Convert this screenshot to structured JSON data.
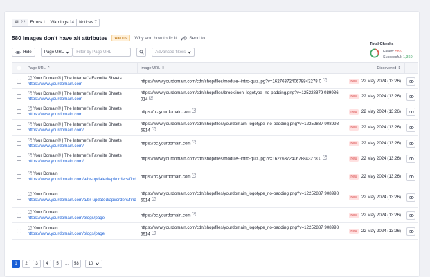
{
  "issue_tabs": [
    {
      "label": "All",
      "count": "22",
      "active": true
    },
    {
      "label": "Errors",
      "count": "1",
      "active": false
    },
    {
      "label": "Warnings",
      "count": "14",
      "active": false
    },
    {
      "label": "Notices",
      "count": "7",
      "active": false
    }
  ],
  "headline": {
    "title": "580 images don't have alt attributes",
    "badge": "warning",
    "why_link": "Why and how to fix it",
    "send_to": "Send to..."
  },
  "total_checks": {
    "label": "Total Checks",
    "info": "i",
    "failed_label": "Failed:",
    "failed_value": "585",
    "successful_label": "Successful:",
    "successful_value": "1,360",
    "fail_fraction": 0.3,
    "failed_color": "#e05a4f",
    "success_color": "#3fa564"
  },
  "controls": {
    "hide_label": "Hide",
    "filter_field": "Page URL",
    "filter_placeholder": "Filter by Page URL",
    "advanced_filters": "Advanced filters"
  },
  "table": {
    "columns": {
      "page_url": "Page URL",
      "image_url": "Image URL",
      "discovered": "Discovered"
    },
    "rows": [
      {
        "page_title": "Your Domain® | The Internet's Favorite Sheets",
        "page_url": "https://www.yourdomain.com",
        "image_url": "https://www.yourdomain.com/cdn/shop/files/module--intro-quiz.jpg?v=1627637240678843278 0",
        "badge": "new",
        "date": "22 May 2024 (13:26)"
      },
      {
        "page_title": "Your Domain® | The Internet's Favorite Sheets",
        "page_url": "https://www.yourdomain.com",
        "image_url": "https://www.yourdomain.com/cdn/shop/files/brooklinen_logotype_no-padding.png?v=125228879 089986914",
        "badge": "new",
        "date": "22 May 2024 (13:26)"
      },
      {
        "page_title": "Your Domain® | The Internet's Favorite Sheets",
        "page_url": "https://www.yourdomain.com",
        "image_url": "https://bc.yourdomain.com",
        "badge": "new",
        "date": "22 May 2024 (13:26)"
      },
      {
        "page_title": "Your Domain® | The Internet's Favorite Sheets",
        "page_url": "https://www.yourdomain.com/",
        "image_url": "https://www.yourdomain.com/cdn/shop/files/yourdomain_logotype_no-padding.png?v=12252887 9089986914",
        "badge": "new",
        "date": "22 May 2024 (13:26)"
      },
      {
        "page_title": "Your Domain® | The Internet's Favorite Sheets",
        "page_url": "https://www.yourdomain.com/",
        "image_url": "https://bc.yourdomain.com",
        "badge": "new",
        "date": "22 May 2024 (13:26)"
      },
      {
        "page_title": "Your Domain® | The Internet's Favorite Sheets",
        "page_url": "https://www.yourdomain.com/",
        "image_url": "https://www.yourdomain.com/cdn/shop/files/module--intro-quiz.jpg?v=1627637240678843278 0",
        "badge": "new",
        "date": "22 May 2024 (13:26)"
      },
      {
        "page_title": "Your Domain",
        "page_url": "https://www.yourdomain.com/a/br-updated/api/orders/find",
        "image_url": "https://bc.yourdomain.com",
        "badge": "new",
        "date": "22 May 2024 (13:26)"
      },
      {
        "page_title": "Your Domain",
        "page_url": "https://www.yourdomain.com/a/br-updated/api/orders/find",
        "image_url": "https://www.yourdomain.com/cdn/shop/files/yourdomain_logotype_no-padding.png?v=12252887 9089986914",
        "badge": "new",
        "date": "22 May 2024 (13:26)"
      },
      {
        "page_title": "Your Domain",
        "page_url": "https://www.yourdomain.com/blogs/page",
        "image_url": "https://bc.yourdomain.com",
        "badge": "new",
        "date": "22 May 2024 (13:26)"
      },
      {
        "page_title": "Your Domain",
        "page_url": "https://www.yourdomain.com/blogs/page",
        "image_url": "https://www.yourdomain.com/cdn/shop/files/yourdomain_logotype_no-padding.png?v=12252887 9089986914",
        "badge": "new",
        "date": "22 May 2024 (13:26)"
      }
    ]
  },
  "pagination": {
    "pages": [
      "1",
      "2",
      "3",
      "4",
      "5"
    ],
    "ellipsis": "...",
    "last": "58",
    "current": "1",
    "per_page": "10"
  }
}
